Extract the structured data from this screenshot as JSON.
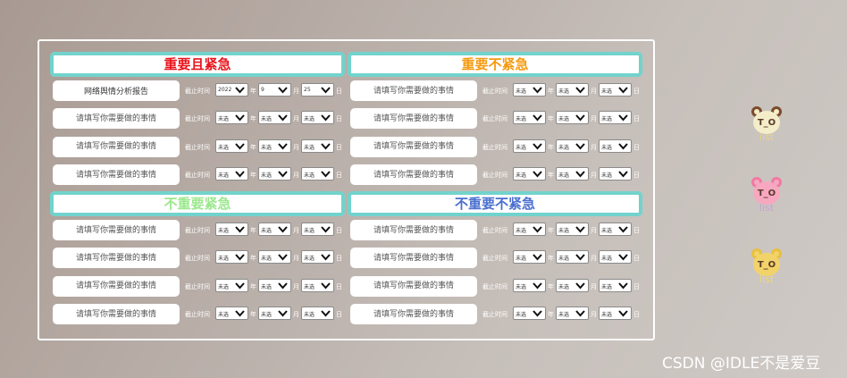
{
  "watermark": "CSDN @IDLE不是爱豆",
  "side_icons": [
    {
      "icon": "bear-todo-list-brown-icon",
      "face": "#f4edc9",
      "ear": "#7a4a2a",
      "text": "#e8d28c"
    },
    {
      "icon": "bear-todo-list-pink-icon",
      "face": "#f7a8c0",
      "ear": "#f07aa2",
      "text": "#c8a0d8"
    },
    {
      "icon": "bear-todo-list-yellow-icon",
      "face": "#f2d36a",
      "ear": "#e8c040",
      "text": "#f0d870"
    }
  ],
  "quadrants": [
    {
      "title": "重要且紧急",
      "color": "#e8141c",
      "tasks": [
        {
          "value": "网络舆情分析报告",
          "placeholder": "请填写你需要做的事情",
          "deadline_label": "截止时间",
          "year": "2022",
          "year_unit": "年",
          "month": "9",
          "month_unit": "月",
          "day": "25",
          "day_unit": "日"
        },
        {
          "value": "",
          "placeholder": "请填写你需要做的事情",
          "deadline_label": "截止时间",
          "year": "未选",
          "year_unit": "年",
          "month": "未选",
          "month_unit": "月",
          "day": "未选",
          "day_unit": "日"
        },
        {
          "value": "",
          "placeholder": "请填写你需要做的事情",
          "deadline_label": "截止时间",
          "year": "未选",
          "year_unit": "年",
          "month": "未选",
          "month_unit": "月",
          "day": "未选",
          "day_unit": "日"
        },
        {
          "value": "",
          "placeholder": "请填写你需要做的事情",
          "deadline_label": "截止时间",
          "year": "未选",
          "year_unit": "年",
          "month": "未选",
          "month_unit": "月",
          "day": "未选",
          "day_unit": "日"
        }
      ]
    },
    {
      "title": "重要不紧急",
      "color": "#f59a10",
      "tasks": [
        {
          "value": "",
          "placeholder": "请填写你需要做的事情",
          "deadline_label": "截止时间",
          "year": "未选",
          "year_unit": "年",
          "month": "未选",
          "month_unit": "月",
          "day": "未选",
          "day_unit": "日"
        },
        {
          "value": "",
          "placeholder": "请填写你需要做的事情",
          "deadline_label": "截止时间",
          "year": "未选",
          "year_unit": "年",
          "month": "未选",
          "month_unit": "月",
          "day": "未选",
          "day_unit": "日"
        },
        {
          "value": "",
          "placeholder": "请填写你需要做的事情",
          "deadline_label": "截止时间",
          "year": "未选",
          "year_unit": "年",
          "month": "未选",
          "month_unit": "月",
          "day": "未选",
          "day_unit": "日"
        },
        {
          "value": "",
          "placeholder": "请填写你需要做的事情",
          "deadline_label": "截止时间",
          "year": "未选",
          "year_unit": "年",
          "month": "未选",
          "month_unit": "月",
          "day": "未选",
          "day_unit": "日"
        }
      ]
    },
    {
      "title": "不重要紧急",
      "color": "#9be88d",
      "tasks": [
        {
          "value": "",
          "placeholder": "请填写你需要做的事情",
          "deadline_label": "截止时间",
          "year": "未选",
          "year_unit": "年",
          "month": "未选",
          "month_unit": "月",
          "day": "未选",
          "day_unit": "日"
        },
        {
          "value": "",
          "placeholder": "请填写你需要做的事情",
          "deadline_label": "截止时间",
          "year": "未选",
          "year_unit": "年",
          "month": "未选",
          "month_unit": "月",
          "day": "未选",
          "day_unit": "日"
        },
        {
          "value": "",
          "placeholder": "请填写你需要做的事情",
          "deadline_label": "截止时间",
          "year": "未选",
          "year_unit": "年",
          "month": "未选",
          "month_unit": "月",
          "day": "未选",
          "day_unit": "日"
        },
        {
          "value": "",
          "placeholder": "请填写你需要做的事情",
          "deadline_label": "截止时间",
          "year": "未选",
          "year_unit": "年",
          "month": "未选",
          "month_unit": "月",
          "day": "未选",
          "day_unit": "日"
        }
      ]
    },
    {
      "title": "不重要不紧急",
      "color": "#4a6fcf",
      "tasks": [
        {
          "value": "",
          "placeholder": "请填写你需要做的事情",
          "deadline_label": "截止时间",
          "year": "未选",
          "year_unit": "年",
          "month": "未选",
          "month_unit": "月",
          "day": "未选",
          "day_unit": "日"
        },
        {
          "value": "",
          "placeholder": "请填写你需要做的事情",
          "deadline_label": "截止时间",
          "year": "未选",
          "year_unit": "年",
          "month": "未选",
          "month_unit": "月",
          "day": "未选",
          "day_unit": "日"
        },
        {
          "value": "",
          "placeholder": "请填写你需要做的事情",
          "deadline_label": "截止时间",
          "year": "未选",
          "year_unit": "年",
          "month": "未选",
          "month_unit": "月",
          "day": "未选",
          "day_unit": "日"
        },
        {
          "value": "",
          "placeholder": "请填写你需要做的事情",
          "deadline_label": "截止时间",
          "year": "未选",
          "year_unit": "年",
          "month": "未选",
          "month_unit": "月",
          "day": "未选",
          "day_unit": "日"
        }
      ]
    }
  ]
}
